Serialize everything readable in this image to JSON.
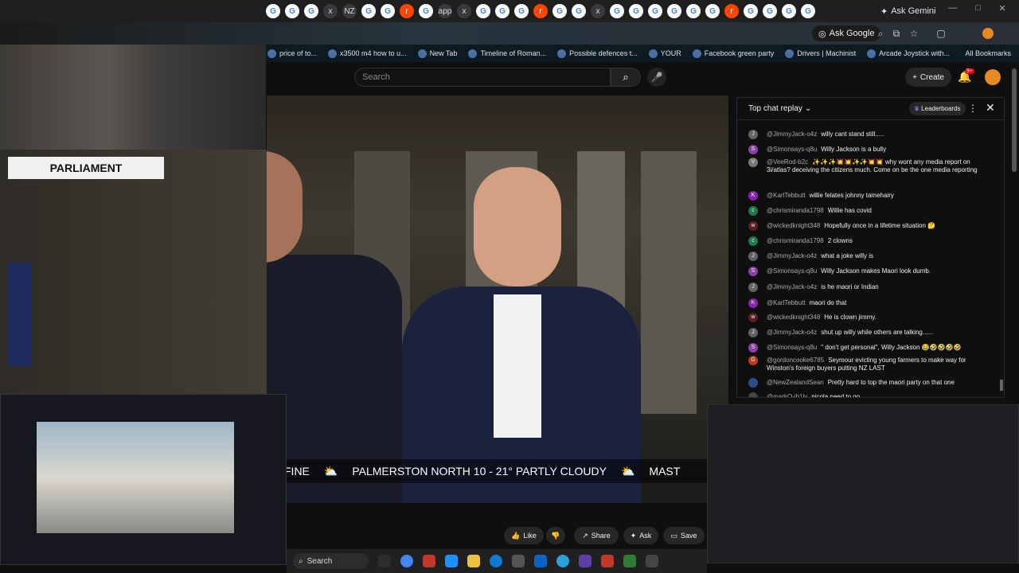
{
  "browser": {
    "tab_icons": [
      "G",
      "G",
      "G",
      "x",
      "NZ",
      "G",
      "G",
      "r",
      "G",
      "app",
      "x",
      "G",
      "G",
      "G",
      "r",
      "G",
      "G",
      "x",
      "G",
      "G",
      "G",
      "G",
      "G",
      "G",
      "r",
      "G",
      "G",
      "G",
      "G"
    ],
    "ask_gemini": "Ask Gemini",
    "ask_google": "Ask Google",
    "bookmarks": [
      "price of to...",
      "x3500 m4 how to u...",
      "New Tab",
      "Timeline of Roman...",
      "Possible defences t...",
      "YOUR",
      "Facebook green party",
      "Drivers | Machinist",
      "Arcade Joystick with..."
    ],
    "all_bookmarks": "All Bookmarks"
  },
  "youtube": {
    "search_placeholder": "Search",
    "create_label": "Create",
    "notif_badge": "9+",
    "actions": {
      "like": "Like",
      "share": "Share",
      "ask": "Ask",
      "save": "Save"
    }
  },
  "video": {
    "ticker": [
      {
        "text": "FINE"
      },
      {
        "text": "PALMERSTON NORTH 10 - 21° PARTLY CLOUDY"
      },
      {
        "text": "MAST"
      }
    ]
  },
  "overlay": {
    "label": "PARLIAMENT"
  },
  "chat": {
    "title": "Top chat replay",
    "leaderboards": "Leaderboards",
    "messages": [
      {
        "author": "@JimmyJack-o4z",
        "text": "willy cant stand still.....",
        "avatar": "J",
        "color": "#5f6368"
      },
      {
        "author": "@Simonsays-q8u",
        "text": "Willy Jackson is a bully",
        "avatar": "S",
        "color": "#8e3fa6"
      },
      {
        "author": "@VeeRod-b2c",
        "text": "✨✨✨💥💥✨✨💥💥 why wont any media report on 3i/atlas? deceiving the citizens much. Come on be the one media reporting",
        "avatar": "V",
        "color": "#777"
      },
      {
        "author": "@KarlTebbutt",
        "text": "willie felates johnny tamehairy",
        "avatar": "K",
        "color": "#8d1fb3"
      },
      {
        "author": "@chrismiranda1798",
        "text": "Willie has covid",
        "avatar": "c",
        "color": "#1f7a4d"
      },
      {
        "author": "@wickedknight348",
        "text": "Hopefully once in a lifetime situation 🤔",
        "avatar": "w",
        "color": "#5a2020"
      },
      {
        "author": "@chrismiranda1798",
        "text": "2 clowns",
        "avatar": "c",
        "color": "#1f7a4d"
      },
      {
        "author": "@JimmyJack-o4z",
        "text": "what a joke willy is",
        "avatar": "J",
        "color": "#5f6368"
      },
      {
        "author": "@Simonsays-q8u",
        "text": "Willy Jackson makes Maori look dumb.",
        "avatar": "S",
        "color": "#8e3fa6"
      },
      {
        "author": "@JimmyJack-o4z",
        "text": "is he maori or Indian",
        "avatar": "J",
        "color": "#5f6368"
      },
      {
        "author": "@KarlTebbutt",
        "text": "maori do that",
        "avatar": "K",
        "color": "#8d1fb3"
      },
      {
        "author": "@wickedknight348",
        "text": "He is clown jimmy.",
        "avatar": "w",
        "color": "#5a2020"
      },
      {
        "author": "@JimmyJack-o4z",
        "text": "shut up willy while others are talking......",
        "avatar": "J",
        "color": "#5f6368"
      },
      {
        "author": "@Simonsays-q8u",
        "text": "\" don't get personal\", Willy Jackson 😂🤣🤣🤣🤣",
        "avatar": "S",
        "color": "#8e3fa6"
      },
      {
        "author": "@gordoncooke6785",
        "text": "Seymour evicting young farmers to make way for Winston's foreign buyers putting NZ LAST",
        "avatar": "G",
        "color": "#c0391f"
      },
      {
        "author": "@NewZealandSean",
        "text": "Pretty hard to top the maori party on that one",
        "avatar": "",
        "color": "#2c4d8a"
      },
      {
        "author": "@markO-ib1lv",
        "text": "nicola need to go",
        "avatar": "",
        "color": "#444"
      }
    ]
  },
  "taskbar": {
    "search_label": "Search"
  }
}
